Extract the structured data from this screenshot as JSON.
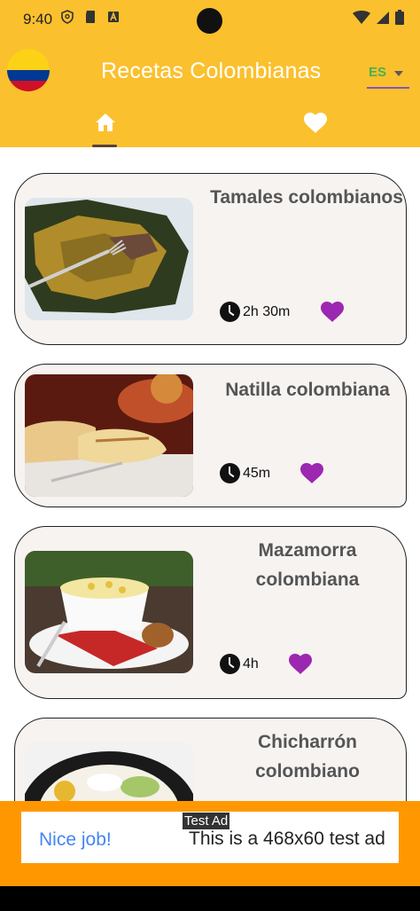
{
  "status_bar": {
    "time": "9:40"
  },
  "app_bar": {
    "title": "Recetas Colombianas",
    "language": "ES",
    "tabs": [
      {
        "icon": "home-icon",
        "selected": true
      },
      {
        "icon": "heart-icon",
        "selected": false
      }
    ]
  },
  "recipes": [
    {
      "title": "Tamales colombianos",
      "time": "2h 30m",
      "favorite": true
    },
    {
      "title": "Natilla colombiana",
      "time": "45m",
      "favorite": true
    },
    {
      "title": "Mazamorra colombiana",
      "time": "4h",
      "favorite": true
    },
    {
      "title": "Chicharrón colombiano",
      "time": "",
      "favorite": true
    }
  ],
  "ad": {
    "label": "Test Ad",
    "headline": "Nice job!",
    "text": "This is a 468x60 test ad"
  },
  "colors": {
    "app_bar": "#fbc02d",
    "heart": "#9c27b0",
    "ad_background": "#ff9800"
  }
}
